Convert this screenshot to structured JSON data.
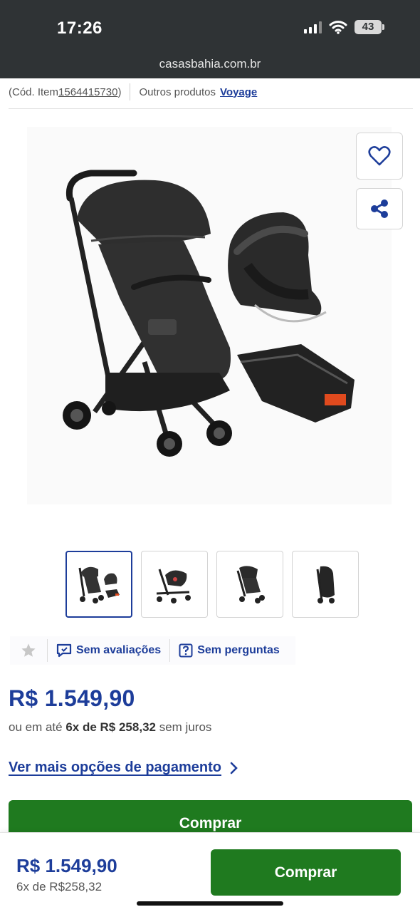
{
  "status_bar": {
    "time": "17:26",
    "battery": "43"
  },
  "browser": {
    "url": "casasbahia.com.br"
  },
  "item_info": {
    "code_prefix": "(Cód. Item ",
    "code": "1564415730",
    "code_suffix": ")",
    "other_products_label": "Outros produtos",
    "brand": "Voyage"
  },
  "product": {
    "image_alt": "Carrinho de bebê Voyage com bebê conforto e base",
    "thumbnails": [
      "stroller-set",
      "stroller-with-seat",
      "stroller",
      "stroller-folded"
    ],
    "selected_thumbnail": 0
  },
  "ratings": {
    "reviews_label": "Sem avaliações",
    "questions_label": "Sem perguntas"
  },
  "price": {
    "main": "R$ 1.549,90",
    "installment_prefix": "ou em até ",
    "installment_bold": "6x de R$ 258,32",
    "installment_suffix": " sem juros",
    "more_options": "Ver mais opções de pagamento"
  },
  "buy_label": "Comprar",
  "footer": {
    "price": "R$ 1.549,90",
    "installments": "6x de R$258,32",
    "buy_label": "Comprar"
  },
  "colors": {
    "brand_blue": "#1d3d9a",
    "buy_green": "#1f7a1f",
    "status_bar": "#2f3335"
  }
}
